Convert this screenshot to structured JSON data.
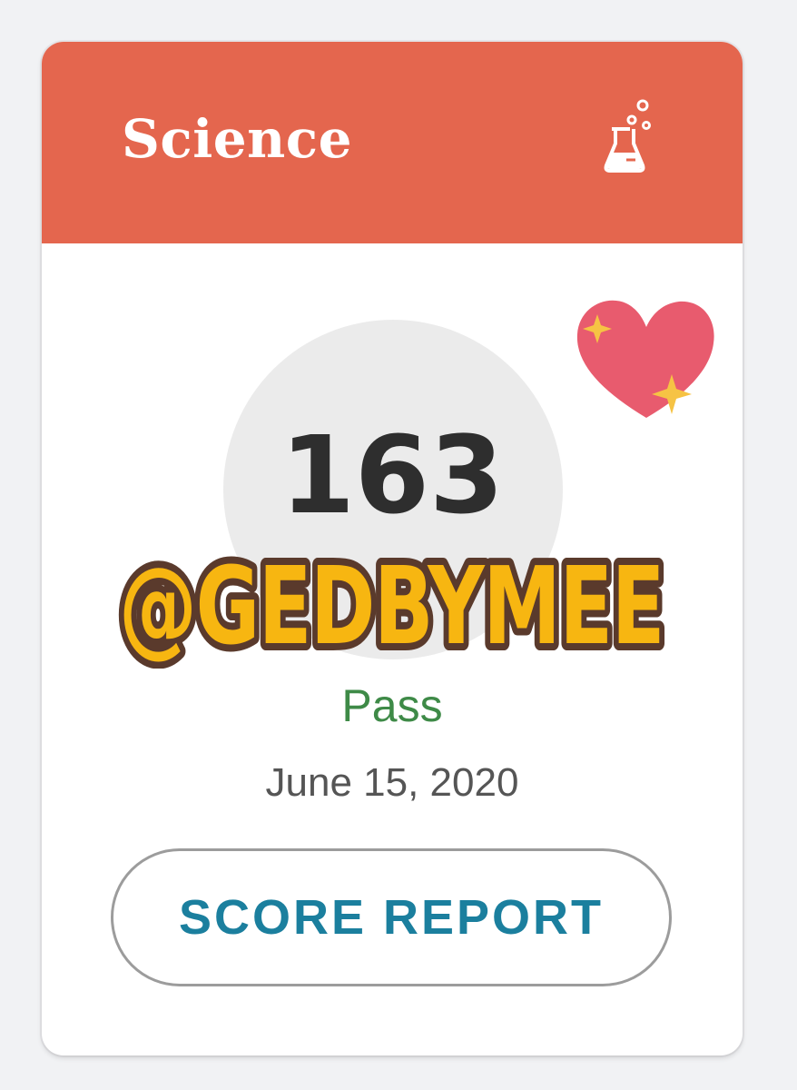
{
  "card": {
    "subject": "Science",
    "header_icon": "flask-icon",
    "score": "163",
    "status": "Pass",
    "date": "June 15, 2020",
    "button_label": "SCORE REPORT"
  },
  "overlay": {
    "watermark_text": "@GEDBYMEE",
    "sticker": "sparkling-heart-icon"
  },
  "colors": {
    "header": "#e4664e",
    "pass": "#3e8a47",
    "button_text": "#1b7f9e",
    "watermark_fill": "#f7b611",
    "watermark_outline": "#5a3a2c",
    "heart": "#e85b6e",
    "sparkle": "#f6c344"
  }
}
